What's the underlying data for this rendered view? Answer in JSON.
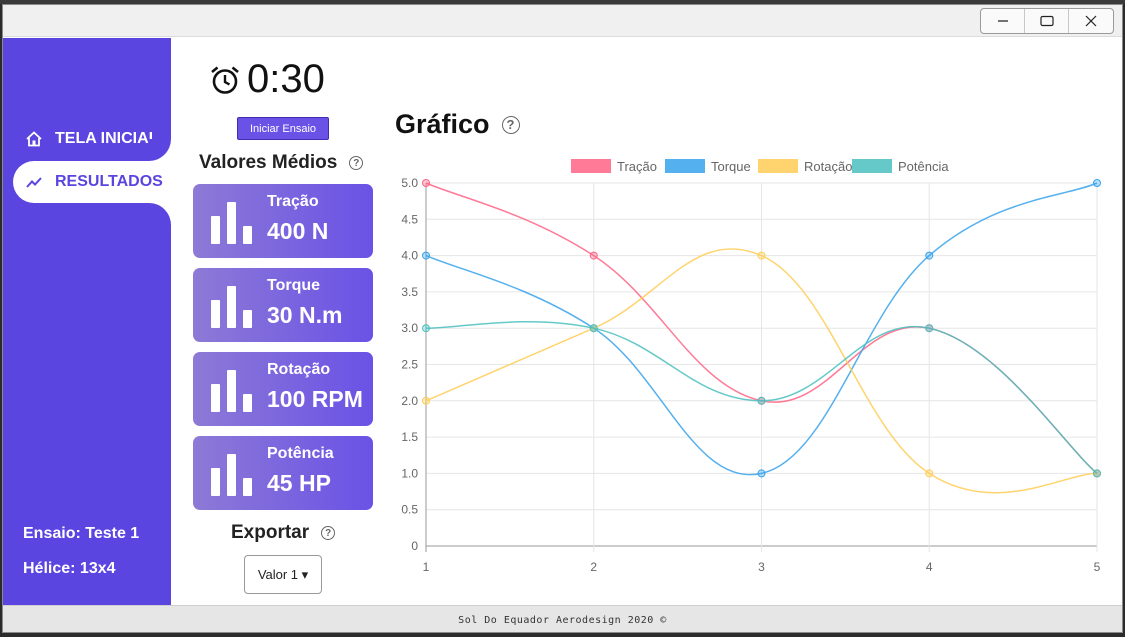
{
  "app": {
    "footer": "Sol Do Equador Aerodesign 2020 ©"
  },
  "window_controls": [
    "minimize-icon",
    "maximize-icon",
    "close-icon"
  ],
  "sidebar": {
    "items": [
      {
        "label": "TELA INICIAL",
        "icon": "home-icon"
      },
      {
        "label": "RESULTADOS",
        "icon": "trend-line-icon"
      }
    ],
    "ensaio": "Ensaio: Teste 1",
    "helice": "Hélice: 13x4"
  },
  "timer": {
    "value": "0:30",
    "icon": "alarm-clock-icon"
  },
  "start_button": "Iniciar Ensaio",
  "averages": {
    "title": "Valores Médios",
    "help": "?",
    "cards": [
      {
        "label": "Tração",
        "value": "400 N"
      },
      {
        "label": "Torque",
        "value": "30 N.m"
      },
      {
        "label": "Rotação",
        "value": "100 RPM"
      },
      {
        "label": "Potência",
        "value": "45 HP"
      }
    ]
  },
  "export": {
    "title": "Exportar",
    "help": "?",
    "selected": "Valor 1 ▾"
  },
  "chart_heading": "Gráfico",
  "chart_data": {
    "type": "line",
    "title": "",
    "x": [
      1,
      2,
      3,
      4,
      5
    ],
    "series": [
      {
        "name": "Tração",
        "values": [
          5,
          4,
          2,
          3,
          1
        ],
        "color": "#ff6384"
      },
      {
        "name": "Torque",
        "values": [
          4,
          3,
          1,
          4,
          5
        ],
        "color": "#36a2eb"
      },
      {
        "name": "Rotação",
        "values": [
          2,
          3,
          4,
          1,
          1
        ],
        "color": "#ffcd56"
      },
      {
        "name": "Potência",
        "values": [
          3,
          3,
          2,
          3,
          1
        ],
        "color": "#4bc0c0"
      }
    ],
    "ylim": [
      0,
      5
    ],
    "yticks": [
      "0",
      "0.5",
      "1.0",
      "1.5",
      "2.0",
      "2.5",
      "3.0",
      "3.5",
      "4.0",
      "4.5",
      "5.0"
    ],
    "xticks": [
      "1",
      "2",
      "3",
      "4",
      "5"
    ],
    "legend": "top",
    "grid": true
  }
}
